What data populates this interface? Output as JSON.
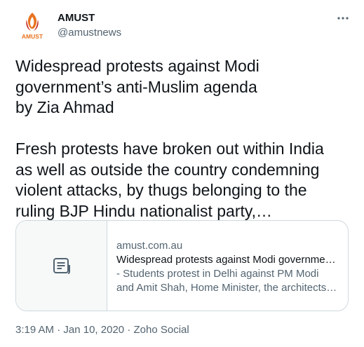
{
  "author": {
    "display_name": "AMUST",
    "handle": "@amustnews",
    "avatar_text": "AMUST"
  },
  "more_icon": "more-horizontal-icon",
  "tweet": {
    "text": "Widespread protests against Modi\ngovernment’s anti-Muslim agenda\nby Zia Ahmad\n\nFresh protests have broken out within India\nas well as outside the country condemning\nviolent attacks, by thugs belonging to the\nruling BJP Hindu nationalist party,…"
  },
  "card": {
    "icon": "article-icon",
    "domain": "amust.com.au",
    "title": "Widespread protests against Modi governmen…",
    "description_line1": "- Students protest in Delhi against PM Modi",
    "description_line2": "and Amit Shah, Home Minister, the architects…"
  },
  "meta": {
    "time": "3:19 AM",
    "separator1": " · ",
    "date": "Jan 10, 2020",
    "separator2": " · ",
    "source": "Zoho Social"
  },
  "colors": {
    "text_primary": "#0f1419",
    "text_secondary": "#536471",
    "border": "#cfd9de",
    "logo_orange": "#e8731f",
    "logo_red": "#c8312b"
  }
}
